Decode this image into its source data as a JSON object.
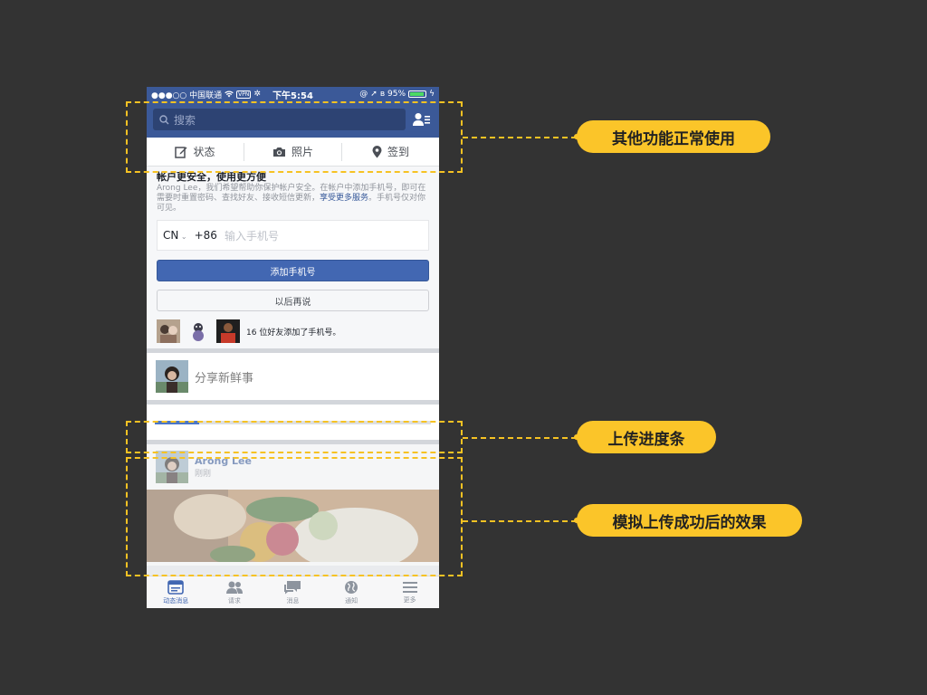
{
  "status_bar": {
    "carrier": "●●●○○ 中国联通",
    "vpn": "VPN",
    "time": "下午5:54",
    "battery": "95%",
    "battery_level": 0.95
  },
  "search": {
    "placeholder": "搜索"
  },
  "actions": [
    {
      "label": "状态",
      "icon": "edit-icon"
    },
    {
      "label": "照片",
      "icon": "camera-icon"
    },
    {
      "label": "签到",
      "icon": "location-pin-icon"
    }
  ],
  "security": {
    "title": "帐户更安全，使用更方便",
    "body": "Arong Lee，我们希望帮助你保护帐户安全。在帐户中添加手机号，即可在需要时重置密码、查找好友、接收短信更新，",
    "link": "享受更多服务",
    "body_end": "。手机号仅对你可见。",
    "country": "CN",
    "dial_code": "+86",
    "phone_placeholder": "输入手机号",
    "add_button": "添加手机号",
    "later_button": "以后再说",
    "friends_text": "16 位好友添加了手机号。"
  },
  "composer": {
    "placeholder": "分享新鲜事"
  },
  "upload": {
    "progress": 0.16
  },
  "post": {
    "author": "Arong Lee",
    "time": "刚刚"
  },
  "tabbar": [
    {
      "label": "动态消息",
      "icon": "news-feed-icon",
      "active": true
    },
    {
      "label": "请求",
      "icon": "friend-requests-icon",
      "active": false
    },
    {
      "label": "消息",
      "icon": "messages-icon",
      "active": false
    },
    {
      "label": "通知",
      "icon": "globe-icon",
      "active": false
    },
    {
      "label": "更多",
      "icon": "menu-icon",
      "active": false
    }
  ],
  "callouts": {
    "top": "其他功能正常使用",
    "middle": "上传进度条",
    "bottom": "模拟上传成功后的效果"
  },
  "colors": {
    "brand": "#3b5998",
    "accent": "#fbc529",
    "background": "#333333"
  }
}
